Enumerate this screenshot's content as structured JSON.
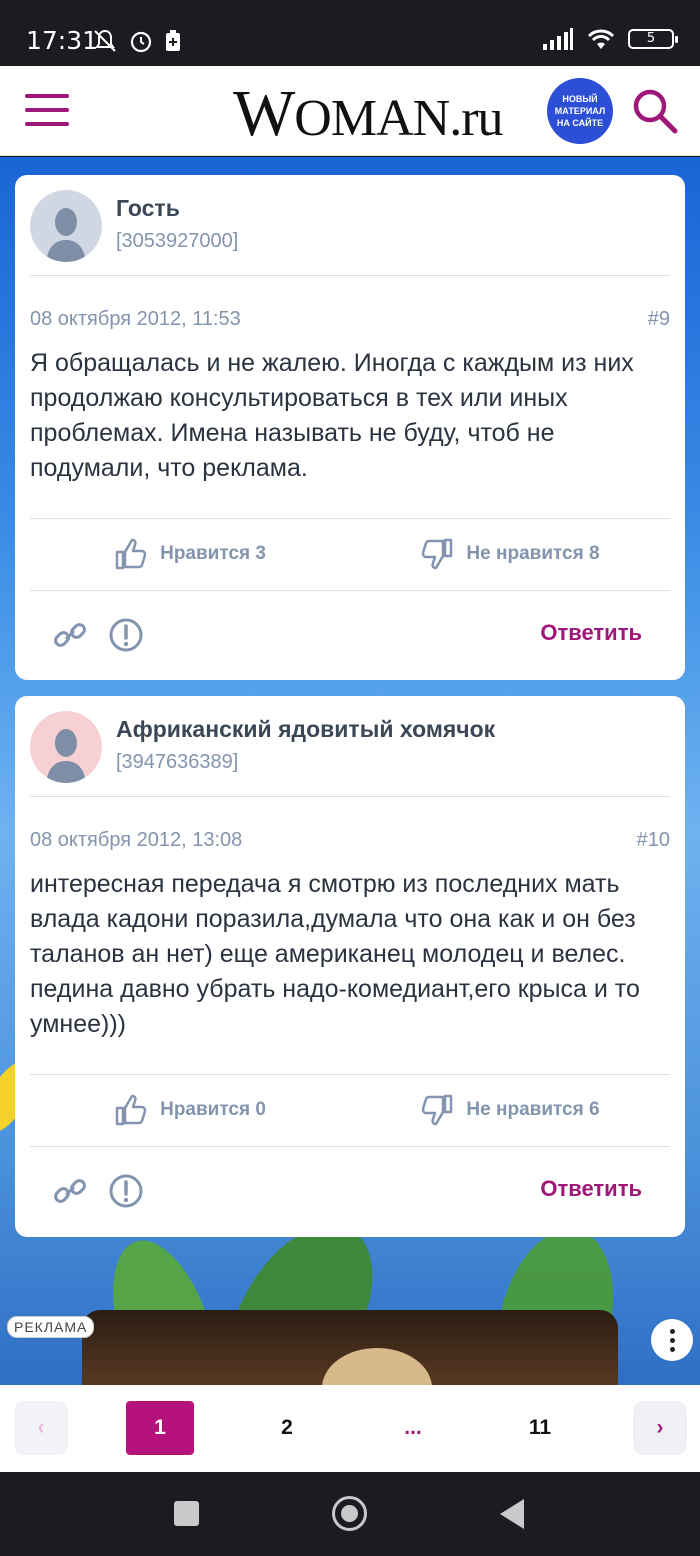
{
  "status_bar": {
    "time": "17:31",
    "battery": "5"
  },
  "header": {
    "logo_first": "W",
    "logo_rest": "OMAN.ru",
    "new_badge": "НОВЫЙ МАТЕРИАЛ НА САЙТЕ",
    "accent_color": "#a0177b"
  },
  "comments": [
    {
      "author": "Гость",
      "uid": "[3053927000]",
      "date": "08 октября 2012, 11:53",
      "number": "#9",
      "text": "Я обращалась и не жалею. Иногда с каждым из них продолжаю консультироваться в тех или иных проблемах. Имена называть не буду, чтоб не подумали, что реклама.",
      "likes_label": "Нравится 3",
      "dislikes_label": "Не нравится 8",
      "reply_label": "Ответить",
      "avatar_color": "#d0d7e2"
    },
    {
      "author": "Африканский ядовитый хомячок",
      "uid": "[3947636389]",
      "date": "08 октября 2012, 13:08",
      "number": "#10",
      "text": "интересная передача я смотрю из последних мать влада кадони поразила,думала что она как и он без таланов ан нет) еще американец молодец и велес. педина давно убрать надо-комедиант,его крыса и то умнее)))",
      "likes_label": "Нравится 0",
      "dislikes_label": "Не нравится 6",
      "reply_label": "Ответить",
      "avatar_color": "#f6d0d3"
    }
  ],
  "ad": {
    "label": "РЕКЛАМА"
  },
  "pagination": {
    "prev": "‹",
    "pages": [
      "1",
      "2",
      "...",
      "11"
    ],
    "current": "1",
    "next": "›"
  }
}
